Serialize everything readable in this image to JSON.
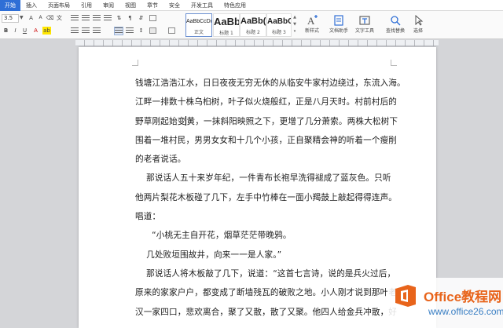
{
  "menu": {
    "items": [
      "开始",
      "插入",
      "页面布局",
      "引用",
      "审阅",
      "视图",
      "章节",
      "安全",
      "开发工具",
      "特色应用"
    ]
  },
  "ribbon": {
    "font_size": "3.5",
    "styles": [
      {
        "sample": "AaBbCcDd",
        "name": "正文"
      },
      {
        "sample": "AaBb",
        "name": "标题 1"
      },
      {
        "sample": "AaBb(",
        "name": "标题 2"
      },
      {
        "sample": "AaBbC",
        "name": "标题 3"
      }
    ],
    "buttons": {
      "new_style": "新样式",
      "doc_assistant": "文档助手",
      "text_tools": "文字工具",
      "find_replace": "查找替换",
      "select": "选择"
    }
  },
  "document": {
    "paragraphs": [
      [
        "钱塘江浩浩江水，日日夜夜无穷无休的从临安牛家村边绕过，东流入海。",
        "江畔一排数十株乌桕树，叶子似火烧般红，正是八月天时。村前村后的",
        "野草刚起始变黄，一抹斜阳映照之下，更增了几分萧索。两株大松树下",
        "围着一堆村民，男男女女和十几个小孩，正自聚精会神的听着一个瘦削",
        "的老者说话。"
      ],
      [
        "    那说话人五十来岁年纪，一件青布长袍早洗得褪成了蓝灰色。只听",
        "他两片梨花木板碰了几下，左手中竹棒在一面小羯鼓上敲起得得连声。",
        "唱道："
      ],
      [
        "      “小桃无主自开花，烟草茫茫带晚鸦。"
      ],
      [
        "    几处败垣围故井，向来一一是人家。”"
      ],
      [
        "    那说话人将木板敲了几下，说道：“这首七言诗，说的是兵火过后，",
        "原来的家家户户，都变成了断墙残瓦的破败之地。小人刚才说到那叶老",
        "汉一家四口，悲欢离合，聚了又散，散了又聚。他四人给金兵冲散，好"
      ]
    ]
  },
  "watermark": {
    "title": "Office教程网",
    "subtitle": "www.office26.com"
  }
}
